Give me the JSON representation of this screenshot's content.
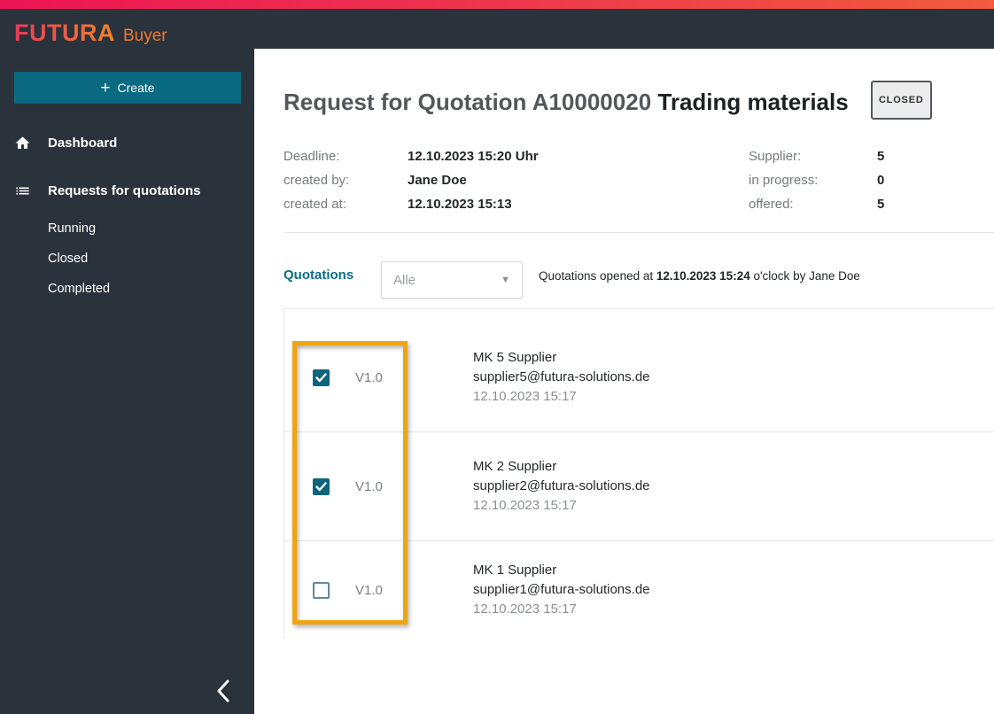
{
  "topbar": {
    "gradient_left": "#EC1555",
    "gradient_right": "#F15B3E"
  },
  "sidebar": {
    "logo": {
      "brand": "FUTURA",
      "product": "Buyer"
    },
    "create_button": {
      "plus": "+",
      "label": "Create"
    },
    "nav": [
      {
        "label": "Dashboard",
        "icon": "home-icon"
      },
      {
        "label": "Requests for quotations",
        "icon": "list-icon"
      }
    ],
    "subnav": [
      {
        "label": "Running"
      },
      {
        "label": "Closed"
      },
      {
        "label": "Completed"
      }
    ]
  },
  "header": {
    "title_prefix": "Request for Quotation A10000020",
    "title_name": "Trading materials",
    "status_badge": "CLOSED"
  },
  "meta": {
    "left": [
      {
        "label": "Deadline:",
        "value": "12.10.2023 15:20 Uhr"
      },
      {
        "label": "created by:",
        "value": "Jane Doe"
      },
      {
        "label": "created at:",
        "value": "12.10.2023 15:13"
      }
    ],
    "right": [
      {
        "label": "Supplier:",
        "value": "5"
      },
      {
        "label": "in progress:",
        "value": "0"
      },
      {
        "label": "offered:",
        "value": "5"
      }
    ]
  },
  "quotations": {
    "section_label": "Quotations",
    "filter_value": "Alle",
    "filter_caret": "▼",
    "opened_prefix": "Quotations opened at ",
    "opened_time": "12.10.2023 15:24",
    "opened_suffix": " o'clock by Jane Doe",
    "rows": [
      {
        "checked": true,
        "version": "V1.0",
        "name": "MK 5 Supplier",
        "email": "supplier5@futura-solutions.de",
        "date": "12.10.2023 15:17"
      },
      {
        "checked": true,
        "version": "V1.0",
        "name": "MK 2 Supplier",
        "email": "supplier2@futura-solutions.de",
        "date": "12.10.2023 15:17"
      },
      {
        "checked": false,
        "version": "V1.0",
        "name": "MK 1 Supplier",
        "email": "supplier1@futura-solutions.de",
        "date": "12.10.2023 15:17"
      }
    ]
  },
  "annotation": {
    "color": "#EDA513"
  },
  "colors": {
    "accent_teal": "#0A6A82",
    "dark_shell": "#2A333C",
    "border_gray": "#E4E6E8"
  }
}
